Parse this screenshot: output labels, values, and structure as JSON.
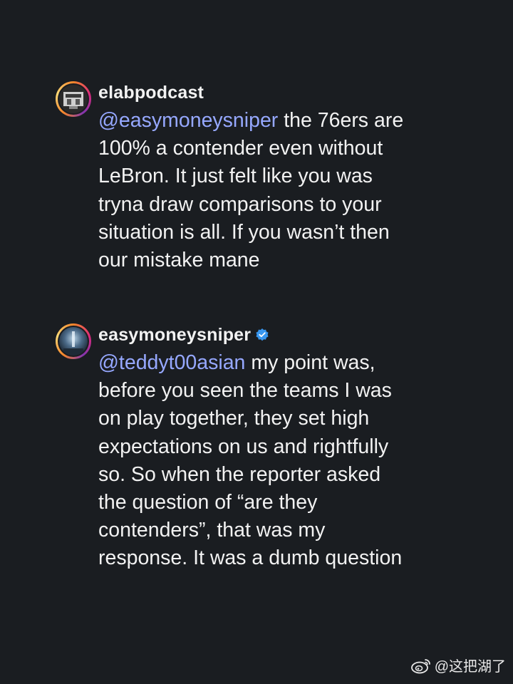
{
  "comments": [
    {
      "username": "elabpodcast",
      "verified": false,
      "mention": "@easymoneysniper",
      "text": " the 76ers are\n100% a contender even without\nLeBron. It just felt like you was\ntryna draw comparisons to your\nsituation is all. If you wasn’t then\nour mistake mane"
    },
    {
      "username": "easymoneysniper",
      "verified": true,
      "mention": "@teddyt00asian",
      "text": " my point was,\nbefore you seen the teams I was\non play together, they set high\nexpectations on us and rightfully\nso. So when the reporter asked\nthe question of “are they\ncontenders”, that was my\nresponse. It was a dumb question"
    }
  ],
  "watermark": {
    "text": "@这把湖了",
    "icon": "weibo-icon"
  },
  "colors": {
    "background": "#1a1d21",
    "text": "#f2f2f2",
    "mention": "#96a8ff",
    "verified_badge": "#3897f0"
  }
}
